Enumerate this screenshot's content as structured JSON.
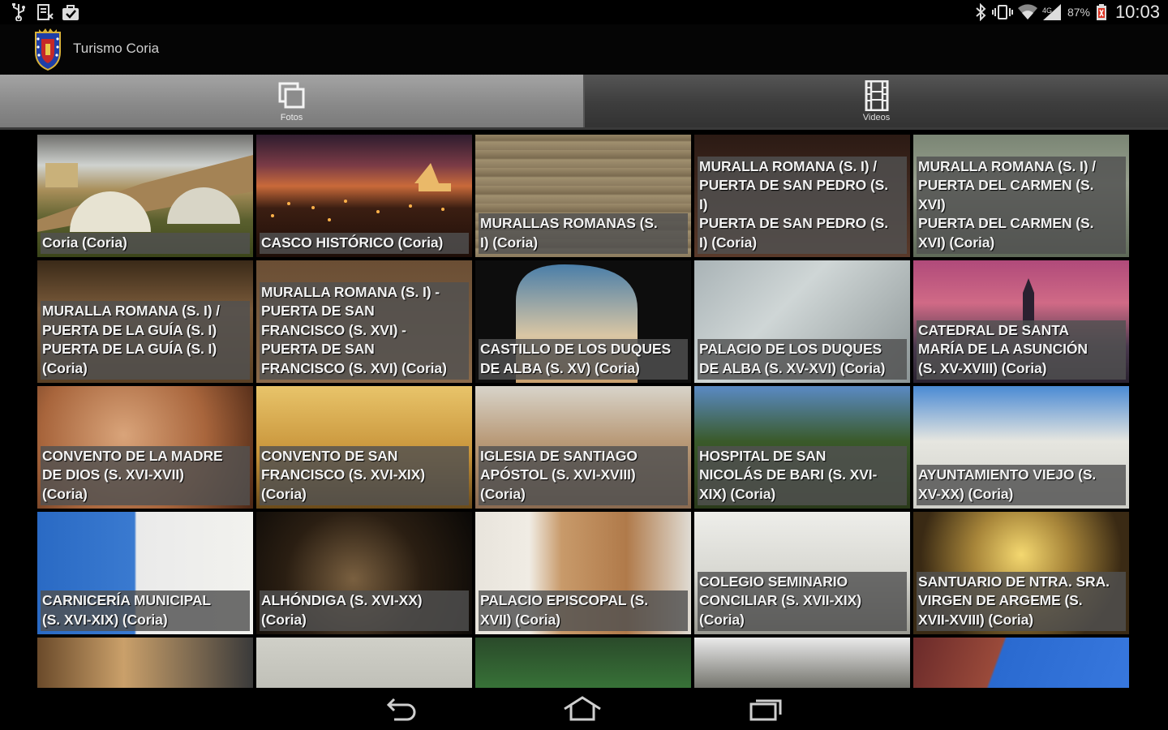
{
  "status_bar": {
    "left_icons": [
      "usb-icon",
      "download-icon",
      "bag-icon"
    ],
    "right_icons": [
      "bluetooth-icon",
      "vibrate-icon",
      "wifi-icon",
      "signal-icon",
      "battery-icon"
    ],
    "battery_text": "87%",
    "time": "10:03"
  },
  "app": {
    "title": "Turismo Coria",
    "logo": "coat-of-arms-icon"
  },
  "tabs": [
    {
      "label": "Fotos",
      "icon": "photos-icon",
      "active": true
    },
    {
      "label": "Videos",
      "icon": "film-icon",
      "active": false
    }
  ],
  "items": [
    {
      "caption": "Coria (Coria)"
    },
    {
      "caption": "CASCO HISTÓRICO (Coria)"
    },
    {
      "caption": "MURALLAS ROMANAS (S.\nI) (Coria)"
    },
    {
      "caption": "MURALLA ROMANA (S. I) /\nPUERTA DE SAN PEDRO (S.\nI)\nPUERTA DE SAN PEDRO (S.\nI) (Coria)"
    },
    {
      "caption": "MURALLA ROMANA (S. I) /\nPUERTA DEL CARMEN (S.\nXVI)\nPUERTA DEL CARMEN (S.\nXVI) (Coria)"
    },
    {
      "caption": "MURALLA ROMANA (S. I) /\nPUERTA DE LA GUÍA (S. I)\nPUERTA DE LA GUÍA (S. I)\n(Coria)"
    },
    {
      "caption": "MURALLA ROMANA (S. I) -\nPUERTA DE SAN\nFRANCISCO (S. XVI) -\nPUERTA DE SAN\nFRANCISCO (S. XVI) (Coria)"
    },
    {
      "caption": "CASTILLO DE LOS DUQUES\nDE ALBA (S. XV) (Coria)"
    },
    {
      "caption": "PALACIO DE LOS DUQUES\nDE ALBA (S. XV-XVI) (Coria)"
    },
    {
      "caption": "CATEDRAL DE SANTA\nMARÍA DE LA ASUNCIÓN\n(S. XV-XVIII) (Coria)"
    },
    {
      "caption": "CONVENTO DE LA MADRE\nDE DIOS (S. XVI-XVII)\n(Coria)"
    },
    {
      "caption": "CONVENTO DE SAN\nFRANCISCO (S. XVI-XIX)\n(Coria)"
    },
    {
      "caption": "IGLESIA DE SANTIAGO\nAPÓSTOL (S. XVI-XVIII)\n(Coria)"
    },
    {
      "caption": "HOSPITAL DE SAN\nNICOLÁS DE BARI (S. XVI-\nXIX) (Coria)"
    },
    {
      "caption": "AYUNTAMIENTO VIEJO (S.\nXV-XX) (Coria)"
    },
    {
      "caption": "CARNICERÍA MUNICIPAL\n(S. XVI-XIX) (Coria)"
    },
    {
      "caption": "ALHÓNDIGA (S. XVI-XX)\n(Coria)"
    },
    {
      "caption": "PALACIO EPISCOPAL (S.\nXVII) (Coria)"
    },
    {
      "caption": "COLEGIO SEMINARIO\nCONCILIAR (S. XVII-XIX)\n(Coria)"
    },
    {
      "caption": "SANTUARIO DE NTRA. SRA.\nVIRGEN DE ARGEME (S.\nXVII-XVIII) (Coria)"
    },
    {
      "caption": ""
    },
    {
      "caption": ""
    },
    {
      "caption": ""
    },
    {
      "caption": ""
    },
    {
      "caption": ""
    }
  ],
  "nav_bar": {
    "buttons": [
      "back-icon",
      "home-icon",
      "recents-icon"
    ]
  }
}
